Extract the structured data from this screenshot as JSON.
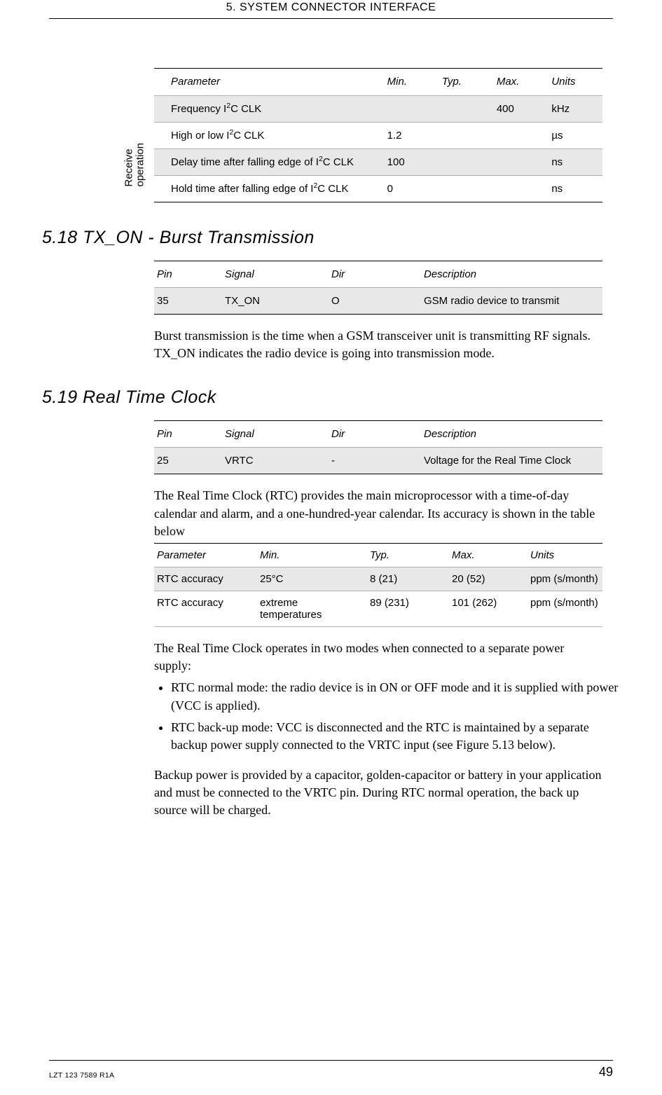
{
  "header": {
    "title": "5. SYSTEM CONNECTOR INTERFACE"
  },
  "table1": {
    "vertical_label_line1": "Receive",
    "vertical_label_line2": "operation",
    "headers": {
      "parameter": "Parameter",
      "min": "Min.",
      "typ": "Typ.",
      "max": "Max.",
      "units": "Units"
    },
    "rows": [
      {
        "param_pre": "Frequency I",
        "param_sup": "2",
        "param_post": "C CLK",
        "min": "",
        "typ": "",
        "max": "400",
        "units": "kHz"
      },
      {
        "param_pre": "High or low I",
        "param_sup": "2",
        "param_post": "C CLK",
        "min": "1.2",
        "typ": "",
        "max": "",
        "units": "µs"
      },
      {
        "param_pre": "Delay time after falling edge of I",
        "param_sup": "2",
        "param_post": "C CLK",
        "min": "100",
        "typ": "",
        "max": "",
        "units": "ns"
      },
      {
        "param_pre": "Hold time after falling edge of I",
        "param_sup": "2",
        "param_post": "C CLK",
        "min": "0",
        "typ": "",
        "max": "",
        "units": "ns"
      }
    ]
  },
  "section518": {
    "title": "5.18 TX_ON - Burst Transmission",
    "pin_headers": {
      "pin": "Pin",
      "signal": "Signal",
      "dir": "Dir",
      "desc": "Description"
    },
    "row": {
      "pin": "35",
      "signal": "TX_ON",
      "dir": "O",
      "desc": "GSM radio device to transmit"
    },
    "para": "Burst transmission is the time when a GSM transceiver unit is transmitting RF signals. TX_ON indicates the radio device is going into transmission mode."
  },
  "section519": {
    "title": "5.19 Real Time Clock",
    "pin_headers": {
      "pin": "Pin",
      "signal": "Signal",
      "dir": "Dir",
      "desc": "Description"
    },
    "row": {
      "pin": "25",
      "signal": "VRTC",
      "dir": "-",
      "desc": "Voltage for the Real Time Clock"
    },
    "para1": "The Real Time Clock (RTC) provides the main microprocessor with a time-of-day calendar and alarm, and a one-hundred-year calendar. Its accuracy is shown in the table below",
    "acc_headers": {
      "param": "Parameter",
      "min": "Min.",
      "typ": "Typ.",
      "max": "Max.",
      "units": "Units"
    },
    "acc_rows": [
      {
        "param": "RTC accuracy",
        "min": "25°C",
        "typ": "8 (21)",
        "max": "20 (52)",
        "units": "ppm (s/month)"
      },
      {
        "param": "RTC accuracy",
        "min": "extreme temperatures",
        "typ": "89 (231)",
        "max": "101 (262)",
        "units": "ppm (s/month)"
      }
    ],
    "para2": "The Real Time Clock operates in two modes when connected to a separate power supply:",
    "bullets": [
      "RTC normal mode: the radio device is in ON or OFF mode and it is supplied with power (VCC is applied).",
      "RTC back-up mode: VCC is disconnected and the RTC is maintained by a separate backup power supply connected to the VRTC input (see Figure 5.13 below)."
    ],
    "para3": "Backup power is provided by a capacitor, golden-capacitor or battery in your application and must be connected to the VRTC pin. During RTC normal operation, the back up source will be charged."
  },
  "footer": {
    "doc_code": "LZT 123 7589 R1A",
    "page_num": "49"
  }
}
